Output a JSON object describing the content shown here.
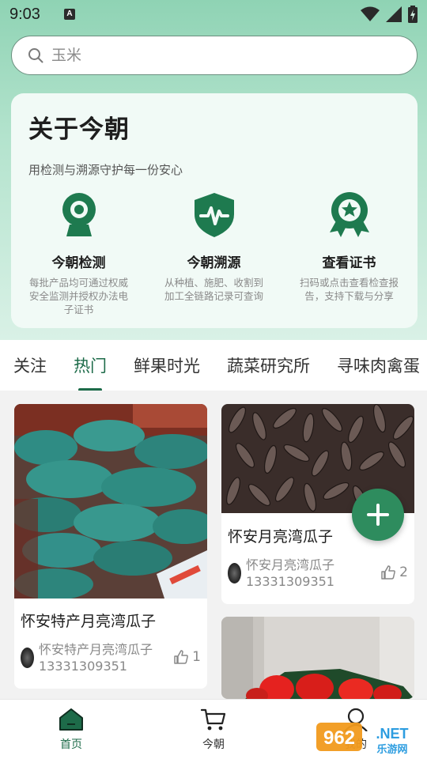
{
  "status_bar": {
    "time": "9:03",
    "notification_badge": "A"
  },
  "search": {
    "placeholder": "玉米"
  },
  "about": {
    "title": "关于今朝",
    "subtitle": "用检测与溯源守护每一份安心",
    "features": [
      {
        "icon": "webcam-icon",
        "name": "今朝检测",
        "desc": "每批产品均可通过权威安全监测并授权办法电子证书"
      },
      {
        "icon": "shield-pulse-icon",
        "name": "今朝溯源",
        "desc": "从种植、施肥、收割到加工全链路记录可查询"
      },
      {
        "icon": "award-ribbon-icon",
        "name": "查看证书",
        "desc": "扫码或点击查看检查报告，支持下载与分享"
      }
    ]
  },
  "tabs": [
    "关注",
    "热门",
    "鲜果时光",
    "蔬菜研究所",
    "寻味肉禽蛋"
  ],
  "active_tab": "热门",
  "feed": [
    {
      "title": "怀安特产月亮湾瓜子",
      "author": "怀安特产月亮湾瓜子",
      "phone": "13331309351",
      "likes": "1",
      "image": "green-sacks-photo"
    },
    {
      "title": "怀安月亮湾瓜子",
      "author": "怀安月亮湾瓜子",
      "phone": "13331309351",
      "likes": "2",
      "image": "sunflower-seeds-photo"
    },
    {
      "image": "strawberries-photo"
    }
  ],
  "fab": {
    "icon": "plus-icon"
  },
  "bottom_nav": [
    {
      "label": "首页",
      "icon": "home-icon",
      "active": true
    },
    {
      "label": "今朝",
      "icon": "cart-icon",
      "active": false
    },
    {
      "label": "我的",
      "icon": "user-icon",
      "active": false
    }
  ],
  "watermark": {
    "brand": "962.NET",
    "caption": "乐游网"
  },
  "colors": {
    "primary": "#1d6b49",
    "fab": "#2e8c5e",
    "hero_gradient_top": "#8fd3b4"
  }
}
